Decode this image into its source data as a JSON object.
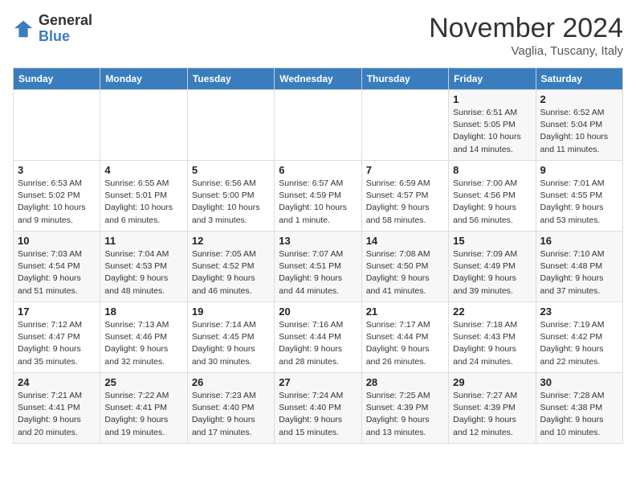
{
  "logo": {
    "general": "General",
    "blue": "Blue"
  },
  "header": {
    "month": "November 2024",
    "location": "Vaglia, Tuscany, Italy"
  },
  "days_of_week": [
    "Sunday",
    "Monday",
    "Tuesday",
    "Wednesday",
    "Thursday",
    "Friday",
    "Saturday"
  ],
  "weeks": [
    [
      {
        "day": "",
        "info": ""
      },
      {
        "day": "",
        "info": ""
      },
      {
        "day": "",
        "info": ""
      },
      {
        "day": "",
        "info": ""
      },
      {
        "day": "",
        "info": ""
      },
      {
        "day": "1",
        "info": "Sunrise: 6:51 AM\nSunset: 5:05 PM\nDaylight: 10 hours and 14 minutes."
      },
      {
        "day": "2",
        "info": "Sunrise: 6:52 AM\nSunset: 5:04 PM\nDaylight: 10 hours and 11 minutes."
      }
    ],
    [
      {
        "day": "3",
        "info": "Sunrise: 6:53 AM\nSunset: 5:02 PM\nDaylight: 10 hours and 9 minutes."
      },
      {
        "day": "4",
        "info": "Sunrise: 6:55 AM\nSunset: 5:01 PM\nDaylight: 10 hours and 6 minutes."
      },
      {
        "day": "5",
        "info": "Sunrise: 6:56 AM\nSunset: 5:00 PM\nDaylight: 10 hours and 3 minutes."
      },
      {
        "day": "6",
        "info": "Sunrise: 6:57 AM\nSunset: 4:59 PM\nDaylight: 10 hours and 1 minute."
      },
      {
        "day": "7",
        "info": "Sunrise: 6:59 AM\nSunset: 4:57 PM\nDaylight: 9 hours and 58 minutes."
      },
      {
        "day": "8",
        "info": "Sunrise: 7:00 AM\nSunset: 4:56 PM\nDaylight: 9 hours and 56 minutes."
      },
      {
        "day": "9",
        "info": "Sunrise: 7:01 AM\nSunset: 4:55 PM\nDaylight: 9 hours and 53 minutes."
      }
    ],
    [
      {
        "day": "10",
        "info": "Sunrise: 7:03 AM\nSunset: 4:54 PM\nDaylight: 9 hours and 51 minutes."
      },
      {
        "day": "11",
        "info": "Sunrise: 7:04 AM\nSunset: 4:53 PM\nDaylight: 9 hours and 48 minutes."
      },
      {
        "day": "12",
        "info": "Sunrise: 7:05 AM\nSunset: 4:52 PM\nDaylight: 9 hours and 46 minutes."
      },
      {
        "day": "13",
        "info": "Sunrise: 7:07 AM\nSunset: 4:51 PM\nDaylight: 9 hours and 44 minutes."
      },
      {
        "day": "14",
        "info": "Sunrise: 7:08 AM\nSunset: 4:50 PM\nDaylight: 9 hours and 41 minutes."
      },
      {
        "day": "15",
        "info": "Sunrise: 7:09 AM\nSunset: 4:49 PM\nDaylight: 9 hours and 39 minutes."
      },
      {
        "day": "16",
        "info": "Sunrise: 7:10 AM\nSunset: 4:48 PM\nDaylight: 9 hours and 37 minutes."
      }
    ],
    [
      {
        "day": "17",
        "info": "Sunrise: 7:12 AM\nSunset: 4:47 PM\nDaylight: 9 hours and 35 minutes."
      },
      {
        "day": "18",
        "info": "Sunrise: 7:13 AM\nSunset: 4:46 PM\nDaylight: 9 hours and 32 minutes."
      },
      {
        "day": "19",
        "info": "Sunrise: 7:14 AM\nSunset: 4:45 PM\nDaylight: 9 hours and 30 minutes."
      },
      {
        "day": "20",
        "info": "Sunrise: 7:16 AM\nSunset: 4:44 PM\nDaylight: 9 hours and 28 minutes."
      },
      {
        "day": "21",
        "info": "Sunrise: 7:17 AM\nSunset: 4:44 PM\nDaylight: 9 hours and 26 minutes."
      },
      {
        "day": "22",
        "info": "Sunrise: 7:18 AM\nSunset: 4:43 PM\nDaylight: 9 hours and 24 minutes."
      },
      {
        "day": "23",
        "info": "Sunrise: 7:19 AM\nSunset: 4:42 PM\nDaylight: 9 hours and 22 minutes."
      }
    ],
    [
      {
        "day": "24",
        "info": "Sunrise: 7:21 AM\nSunset: 4:41 PM\nDaylight: 9 hours and 20 minutes."
      },
      {
        "day": "25",
        "info": "Sunrise: 7:22 AM\nSunset: 4:41 PM\nDaylight: 9 hours and 19 minutes."
      },
      {
        "day": "26",
        "info": "Sunrise: 7:23 AM\nSunset: 4:40 PM\nDaylight: 9 hours and 17 minutes."
      },
      {
        "day": "27",
        "info": "Sunrise: 7:24 AM\nSunset: 4:40 PM\nDaylight: 9 hours and 15 minutes."
      },
      {
        "day": "28",
        "info": "Sunrise: 7:25 AM\nSunset: 4:39 PM\nDaylight: 9 hours and 13 minutes."
      },
      {
        "day": "29",
        "info": "Sunrise: 7:27 AM\nSunset: 4:39 PM\nDaylight: 9 hours and 12 minutes."
      },
      {
        "day": "30",
        "info": "Sunrise: 7:28 AM\nSunset: 4:38 PM\nDaylight: 9 hours and 10 minutes."
      }
    ]
  ]
}
